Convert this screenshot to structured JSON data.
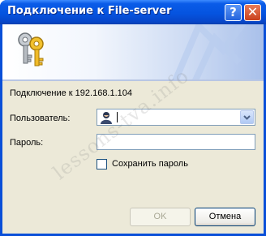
{
  "window": {
    "title": "Подключение к  File-server",
    "help_glyph": "?",
    "close_glyph": "✕"
  },
  "dialog": {
    "connect_text": "Подключение к 192.168.1.104",
    "user_label": "Пользователь:",
    "user_value": "",
    "password_label": "Пароль:",
    "password_value": "",
    "remember_label": "Сохранить пароль",
    "remember_checked": false,
    "ok_label": "OK",
    "cancel_label": "Отмена"
  },
  "watermark": "lessons-tva.info",
  "icons": {
    "banner": "keys-icon",
    "user": "user-icon",
    "dropdown": "chevron-down-icon"
  },
  "colors": {
    "titlebar": "#0554e0",
    "client": "#ece9d8",
    "field_border": "#7f9db9"
  }
}
